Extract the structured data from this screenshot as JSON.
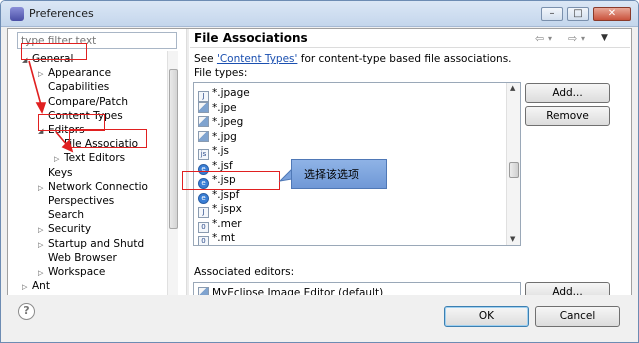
{
  "window": {
    "title": "Preferences",
    "controls": {
      "minimize": "–",
      "maximize": "□",
      "close": "✕"
    }
  },
  "sidebar": {
    "filter_placeholder": "type filter text",
    "tree": [
      {
        "label": "General",
        "expanded": true,
        "depth": 0
      },
      {
        "label": "Appearance",
        "depth": 1,
        "expandable": true
      },
      {
        "label": "Capabilities",
        "depth": 1
      },
      {
        "label": "Compare/Patch",
        "depth": 1
      },
      {
        "label": "Content Types",
        "depth": 1
      },
      {
        "label": "Editors",
        "expanded": true,
        "depth": 1
      },
      {
        "label": "File Associatio",
        "depth": 2,
        "selected": true
      },
      {
        "label": "Text Editors",
        "depth": 2,
        "expandable": true
      },
      {
        "label": "Keys",
        "depth": 1
      },
      {
        "label": "Network Connectio",
        "depth": 1,
        "expandable": true
      },
      {
        "label": "Perspectives",
        "depth": 1
      },
      {
        "label": "Search",
        "depth": 1
      },
      {
        "label": "Security",
        "depth": 1,
        "expandable": true
      },
      {
        "label": "Startup and Shutd",
        "depth": 1,
        "expandable": true
      },
      {
        "label": "Web Browser",
        "depth": 1
      },
      {
        "label": "Workspace",
        "depth": 1,
        "expandable": true
      },
      {
        "label": "Ant",
        "depth": 0,
        "expandable": true
      }
    ]
  },
  "page": {
    "title": "File Associations",
    "see_prefix": "See ",
    "see_link": "'Content Types'",
    "see_suffix": " for content-type based file associations.",
    "file_types_label": "File types:",
    "file_types": [
      {
        "name": "*.jpage",
        "icon": "java-page-icon"
      },
      {
        "name": "*.jpe",
        "icon": "image-file-icon"
      },
      {
        "name": "*.jpeg",
        "icon": "image-file-icon"
      },
      {
        "name": "*.jpg",
        "icon": "image-file-icon"
      },
      {
        "name": "*.js",
        "icon": "javascript-file-icon"
      },
      {
        "name": "*.jsf",
        "icon": "jsp-file-icon"
      },
      {
        "name": "*.jsp",
        "icon": "jsp-file-icon"
      },
      {
        "name": "*.jspf",
        "icon": "jsp-file-icon"
      },
      {
        "name": "*.jspx",
        "icon": "jspx-file-icon"
      },
      {
        "name": "*.mer",
        "icon": "text-file-icon"
      },
      {
        "name": "*.mt",
        "icon": "text-file-icon"
      }
    ],
    "add_button": "Add...",
    "remove_button": "Remove",
    "assoc_label": "Associated editors:",
    "assoc_items": [
      {
        "name": "MyEclipse Image Editor (default)",
        "icon": "image-file-icon"
      }
    ],
    "assoc_add_button": "Add..."
  },
  "footer": {
    "help_symbol": "?",
    "ok_button": "OK",
    "cancel_button": "Cancel"
  },
  "annotation": {
    "callout_text": "选择该选项",
    "color": "#e02020"
  }
}
